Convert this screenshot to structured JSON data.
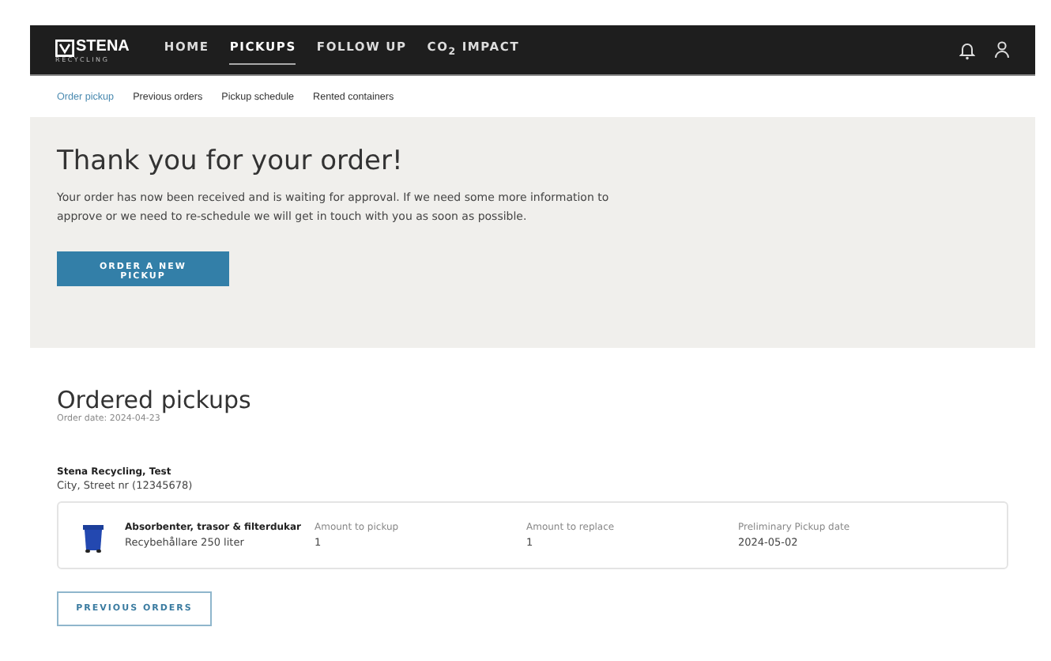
{
  "header": {
    "logo": {
      "name": "STENA",
      "sub": "RECYCLING"
    },
    "nav": [
      {
        "label": "HOME",
        "selected": false
      },
      {
        "label": "PICKUPS",
        "selected": true
      },
      {
        "label": "FOLLOW UP",
        "selected": false
      },
      {
        "label": "CO$_{2}$ IMPACT",
        "selected": false
      }
    ]
  },
  "subnav": [
    {
      "label": "Order pickup",
      "selected": true
    },
    {
      "label": "Previous orders",
      "selected": false
    },
    {
      "label": "Pickup schedule",
      "selected": false
    },
    {
      "label": "Rented containers",
      "selected": false
    }
  ],
  "confirmation": {
    "title": "Thank you for your order!",
    "message": "Your order has now been received and is waiting for approval. If we need some more information to approve or we need to re-schedule we will get in touch with you as soon as possible.",
    "button": "ORDER A NEW PICKUP"
  },
  "ordered": {
    "title": "Ordered pickups",
    "order_date": "Order date: 2024-04-23",
    "customer": "Stena Recycling, Test",
    "address": "City, Street nr (12345678)",
    "items": [
      {
        "name": "Absorbenter, trasor & filterdukar",
        "container": "Recybehållare 250 liter",
        "fields": [
          {
            "label": "Amount to pickup",
            "value": "1"
          },
          {
            "label": "Amount to replace",
            "value": "1"
          },
          {
            "label": "Preliminary Pickup date",
            "value": "2024-05-02"
          }
        ]
      }
    ],
    "button": "PREVIOUS ORDERS"
  }
}
